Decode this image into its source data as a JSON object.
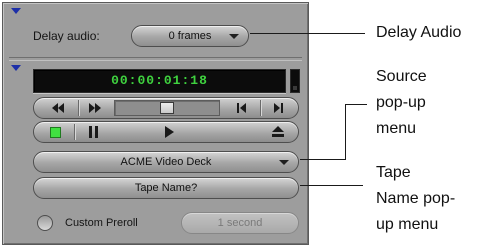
{
  "panel": {
    "delay_label": "Delay audio:",
    "delay_value": "0 frames",
    "timecode": "00:00:01:18",
    "deck": "ACME Video Deck",
    "tape": "Tape Name?",
    "custom_preroll_label": "Custom Preroll",
    "preroll_value": "1 second"
  },
  "callouts": {
    "delay_audio": "Delay Audio",
    "source_line1": "Source",
    "source_line2": "pop-up",
    "source_line3": "menu",
    "tape_line1": "Tape",
    "tape_line2": "Name pop-",
    "tape_line3": "up menu"
  },
  "colors": {
    "panel_bg": "#9d9d9d",
    "timecode_text": "#3fd23f",
    "disclosure_triangle": "#1d2fa8",
    "stop_button_green": "#41e041"
  },
  "icons": [
    "disclosure-triangle-icon",
    "chevron-down-icon",
    "rewind-icon",
    "fast-forward-icon",
    "step-back-icon",
    "step-forward-icon",
    "stop-icon",
    "pause-icon",
    "play-icon",
    "eject-icon"
  ]
}
